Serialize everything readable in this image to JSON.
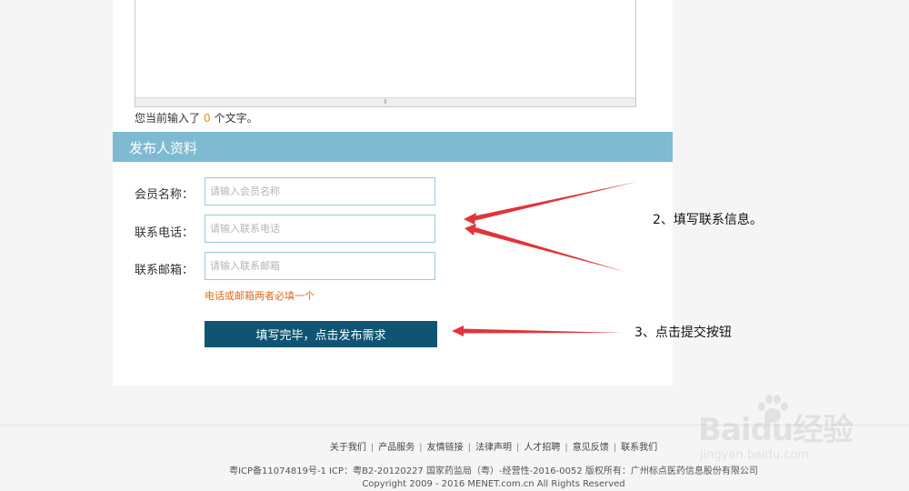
{
  "editor": {
    "char_count_prefix": "您当前输入了",
    "char_count_value": "0",
    "char_count_suffix": "个文字。"
  },
  "section": {
    "title": "发布人资料"
  },
  "form": {
    "member_name_label": "会员名称：",
    "member_name_placeholder": "请输入会员名称",
    "phone_label": "联系电话：",
    "phone_placeholder": "请输入联系电话",
    "email_label": "联系邮箱：",
    "email_placeholder": "请输入联系邮箱",
    "hint": "电话或邮箱两者必填一个",
    "submit_label": "填写完毕，点击发布需求"
  },
  "annotations": {
    "step2": "2、填写联系信息。",
    "step3": "3、点击提交按钮"
  },
  "colors": {
    "section_header": "#7fbad3",
    "submit_button": "#0f5573",
    "arrow": "#e0343a",
    "hint": "#e06a1a"
  },
  "footer": {
    "links": [
      "关于我们",
      "产品服务",
      "友情链接",
      "法律声明",
      "人才招聘",
      "意见反馈",
      "联系我们"
    ],
    "icp": "粤ICP备11074819号-1 ICP：粤B2-20120227 国家药监局（粤）-经营性-2016-0052 版权所有：广州标点医药信息股份有限公司",
    "copyright": "Copyright 2009 - 2016 MENET.com.cn All Rights Reserved"
  },
  "watermark": {
    "logo_text": "Baidu经验",
    "url": "jingyan.baidu.com"
  }
}
